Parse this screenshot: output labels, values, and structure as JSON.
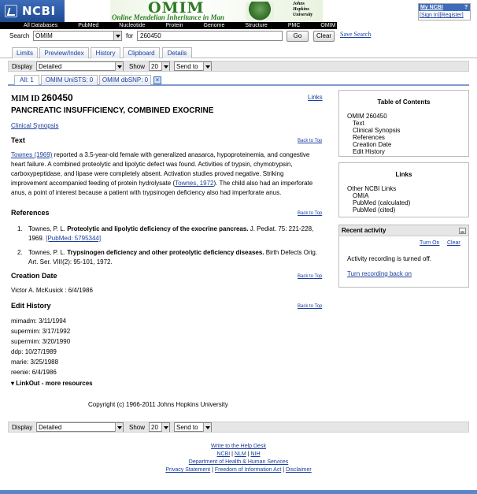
{
  "header": {
    "ncbi_logo": "NCBI",
    "omim_title": "OMIM",
    "omim_subtitle": "Online Mendelian Inheritance in Man",
    "jhu_line1": "Johns",
    "jhu_line2": "Hopkins",
    "jhu_line3": "University",
    "my_ncbi": "My NCBI",
    "my_ncbi_help": "?",
    "sign_in": "[Sign In]",
    "register": "[Register]"
  },
  "nav": [
    "All Databases",
    "PubMed",
    "Nucleotide",
    "Protein",
    "Genome",
    "Structure",
    "PMC",
    "OMIM"
  ],
  "search": {
    "label": "Search",
    "database": "OMIM",
    "for_label": "for",
    "query": "260450",
    "go_button": "Go",
    "clear_button": "Clear",
    "save_search": "Save Search"
  },
  "tabs": [
    "Limits",
    "Preview/Index",
    "History",
    "Clipboard",
    "Details"
  ],
  "display_bar": {
    "display_label": "Display",
    "display_value": "Detailed",
    "show_label": "Show",
    "show_value": "20",
    "send_to": "Send to"
  },
  "result_tabs": [
    "All: 1",
    "OMIM UniSTS: 0",
    "OMIM dbSNP: 0"
  ],
  "record": {
    "mim_prefix": "MIM ID",
    "mim_number": "260450",
    "links": "Links",
    "title": "PANCREATIC INSUFFICIENCY, COMBINED EXOCRINE",
    "clinical_synopsis": "Clinical Synopsis",
    "back_to_top": "Back to Top",
    "text_heading": "Text",
    "text_ref1": "Townes (1969)",
    "text_p1": " reported a 3.5-year-old female with generalized anasarca, hypoproteinemia, and congestive heart failure. A combined proteolytic and lipolytic defect was found. Activities of trypsin, chymotrypsin, carboxypeptidase, and lipase were completely absent. Activation studies proved negative. Striking improvement accompanied feeding of protein hydrolysate (",
    "text_ref2": "Townes, 1972",
    "text_p2": "). The child also had an imperforate anus, a point of interest because a patient with trypsinogen deficiency also had imperforate anus.",
    "references_heading": "References",
    "ref1_num": "1.",
    "ref1_author": "Townes, P. L. ",
    "ref1_title": "Proteolytic and lipolytic deficiency of the exocrine pancreas.",
    "ref1_source": " J. Pediat. 75: 221-228, 1969. ",
    "ref1_pubmed": "[PubMed: 5795344]",
    "ref2_num": "2.",
    "ref2_author": "Townes, P. L. ",
    "ref2_title": "Trypsinogen deficiency and other proteolytic deficiency diseases.",
    "ref2_source": " Birth Defects Orig. Art. Ser. VIII(2): 95-101, 1972.",
    "creation_heading": "Creation Date",
    "creation_value": "Victor A. McKusick : 6/4/1986",
    "edit_heading": "Edit History",
    "edit_history": [
      "mimadm: 3/11/1994",
      "supermim: 3/17/1992",
      "supermim: 3/20/1990",
      "ddp: 10/27/1989",
      "marie: 3/25/1988",
      "reenie: 6/4/1986"
    ],
    "linkout": "LinkOut - more resources",
    "copyright": "Copyright (c) 1966-2011 Johns Hopkins University"
  },
  "sidebar": {
    "toc_heading": "Table of Contents",
    "toc_items": [
      "OMIM 260450",
      "Text",
      "Clinical Synopsis",
      "References",
      "Creation Date",
      "Edit History"
    ],
    "links_heading": "Links",
    "links_items": [
      "Other NCBI Links",
      "OMIA",
      "PubMed (calculated)",
      "PubMed (cited)"
    ],
    "recent_heading": "Recent activity",
    "turn_on": "Turn On",
    "clear": "Clear",
    "recording_off": "Activity recording is turned off.",
    "turn_back_on": "Turn recording back on"
  },
  "footer": {
    "help_desk": "Write to the Help Desk",
    "ncbi": "NCBI",
    "nlm": "NLM",
    "nih": "NIH",
    "sep": " | ",
    "hhs": "Department of Health & Human Services",
    "privacy": "Privacy Statement",
    "foia": "Freedom of Information Act",
    "disclaimer": "Disclaimer"
  }
}
